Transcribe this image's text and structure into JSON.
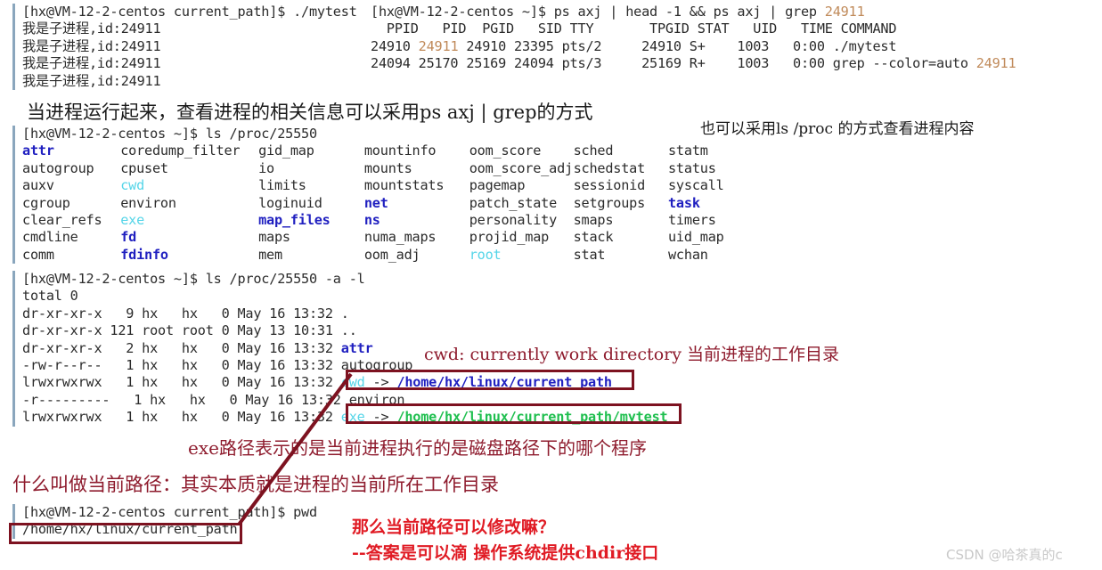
{
  "terminal_top_left": {
    "lines": [
      "[hx@VM-12-2-centos current_path]$ ./mytest",
      "我是子进程,id:24911",
      "我是子进程,id:24911",
      "我是子进程,id:24911",
      "我是子进程,id:24911"
    ]
  },
  "terminal_top_right": {
    "prompt": "[hx@VM-12-2-centos ~]$ ps axj | head -1 && ps axj | grep ",
    "prompt_pid": "24911",
    "header": "  PPID   PID  PGID   SID TTY       TPGID STAT   UID   TIME COMMAND",
    "rows": [
      {
        "pre": "24910 ",
        "pid": "24911",
        "post": " 24910 23395 pts/2     24910 S+    1003   0:00 ./mytest"
      },
      {
        "pre": "24094 25170 25169 24094 pts/3     25169 R+    1003   0:00 grep --color=auto ",
        "pid": "24911",
        "post": ""
      }
    ]
  },
  "annotation_ps": "当进程运行起来，查看进程的相关信息可以采用ps axj | grep的方式",
  "annotation_ls_proc": "也可以采用ls /proc 的方式查看进程内容",
  "terminal_proc_ls": {
    "prompt": "[hx@VM-12-2-centos ~]$ ls /proc/25550",
    "columns": [
      [
        {
          "name": "attr",
          "kind": "dir"
        },
        {
          "name": "autogroup",
          "kind": "plain"
        },
        {
          "name": "auxv",
          "kind": "plain"
        },
        {
          "name": "cgroup",
          "kind": "plain"
        },
        {
          "name": "clear_refs",
          "kind": "plain"
        },
        {
          "name": "cmdline",
          "kind": "plain"
        },
        {
          "name": "comm",
          "kind": "plain"
        }
      ],
      [
        {
          "name": "coredump_filter",
          "kind": "plain"
        },
        {
          "name": "cpuset",
          "kind": "plain"
        },
        {
          "name": "cwd",
          "kind": "link"
        },
        {
          "name": "environ",
          "kind": "plain"
        },
        {
          "name": "exe",
          "kind": "link"
        },
        {
          "name": "fd",
          "kind": "dir"
        },
        {
          "name": "fdinfo",
          "kind": "dir"
        }
      ],
      [
        {
          "name": "gid_map",
          "kind": "plain"
        },
        {
          "name": "io",
          "kind": "plain"
        },
        {
          "name": "limits",
          "kind": "plain"
        },
        {
          "name": "loginuid",
          "kind": "plain"
        },
        {
          "name": "map_files",
          "kind": "dir"
        },
        {
          "name": "maps",
          "kind": "plain"
        },
        {
          "name": "mem",
          "kind": "plain"
        }
      ],
      [
        {
          "name": "mountinfo",
          "kind": "plain"
        },
        {
          "name": "mounts",
          "kind": "plain"
        },
        {
          "name": "mountstats",
          "kind": "plain"
        },
        {
          "name": "net",
          "kind": "dir"
        },
        {
          "name": "ns",
          "kind": "dir"
        },
        {
          "name": "numa_maps",
          "kind": "plain"
        },
        {
          "name": "oom_adj",
          "kind": "plain"
        }
      ],
      [
        {
          "name": "oom_score",
          "kind": "plain"
        },
        {
          "name": "oom_score_adj",
          "kind": "plain"
        },
        {
          "name": "pagemap",
          "kind": "plain"
        },
        {
          "name": "patch_state",
          "kind": "plain"
        },
        {
          "name": "personality",
          "kind": "plain"
        },
        {
          "name": "projid_map",
          "kind": "plain"
        },
        {
          "name": "root",
          "kind": "link"
        }
      ],
      [
        {
          "name": "sched",
          "kind": "plain"
        },
        {
          "name": "schedstat",
          "kind": "plain"
        },
        {
          "name": "sessionid",
          "kind": "plain"
        },
        {
          "name": "setgroups",
          "kind": "plain"
        },
        {
          "name": "smaps",
          "kind": "plain"
        },
        {
          "name": "stack",
          "kind": "plain"
        },
        {
          "name": "stat",
          "kind": "plain"
        }
      ],
      [
        {
          "name": "statm",
          "kind": "plain"
        },
        {
          "name": "status",
          "kind": "plain"
        },
        {
          "name": "syscall",
          "kind": "plain"
        },
        {
          "name": "task",
          "kind": "dir"
        },
        {
          "name": "timers",
          "kind": "plain"
        },
        {
          "name": "uid_map",
          "kind": "plain"
        },
        {
          "name": "wchan",
          "kind": "plain"
        }
      ]
    ]
  },
  "terminal_proc_ll": {
    "prompt": "[hx@VM-12-2-centos ~]$ ls /proc/25550 -a -l",
    "total": "total 0",
    "entries": [
      {
        "meta": "dr-xr-xr-x   9 hx   hx   0 May 16 13:32 ",
        "name": ".",
        "kind": "plain",
        "arrow": "",
        "target": "",
        "target_kind": ""
      },
      {
        "meta": "dr-xr-xr-x 121 root root 0 May 13 10:31 ",
        "name": "..",
        "kind": "plain",
        "arrow": "",
        "target": "",
        "target_kind": ""
      },
      {
        "meta": "dr-xr-xr-x   2 hx   hx   0 May 16 13:32 ",
        "name": "attr",
        "kind": "dir",
        "arrow": "",
        "target": "",
        "target_kind": ""
      },
      {
        "meta": "-rw-r--r--   1 hx   hx   0 May 16 13:32 ",
        "name": "autogroup",
        "kind": "plain",
        "arrow": "",
        "target": "",
        "target_kind": ""
      },
      {
        "meta": "lrwxrwxrwx   1 hx   hx   0 May 16 13:32 ",
        "name": "cwd",
        "kind": "link",
        "arrow": " -> ",
        "target": "/home/hx/linux/current_path",
        "target_kind": "dir"
      },
      {
        "meta": "-r---------   1 hx   hx   0 May 16 13:32 ",
        "name": "environ",
        "kind": "plain",
        "arrow": "",
        "target": "",
        "target_kind": ""
      },
      {
        "meta": "lrwxrwxrwx   1 hx   hx   0 May 16 13:32 ",
        "name": "exe",
        "kind": "link",
        "arrow": " -> ",
        "target": "/home/hx/linux/current_path/mytest",
        "target_kind": "exe"
      }
    ]
  },
  "annotation_cwd": "cwd: currently work directory 当前进程的工作目录",
  "annotation_exe": "exe路径表示的是当前进程执行的是磁盘路径下的哪个程序",
  "annotation_current_path": "什么叫做当前路径：其实本质就是进程的当前所在工作目录",
  "terminal_pwd": {
    "prompt": "[hx@VM-12-2-centos current_path]$ pwd",
    "output": "/home/hx/linux/current_path"
  },
  "annotation_question": "那么当前路径可以修改嘛？",
  "annotation_answer": "--答案是可以滴 操作系统提供chdir接口",
  "watermark": "CSDN @哈茶真的c",
  "colors": {
    "terminal_text": "#2b2b2b",
    "terminal_bar": "#8aa6bd",
    "dir": "#2020c0",
    "symlink": "#55d5e8",
    "executable": "#1fbf4f",
    "grep_highlight": "#c08a5a",
    "annotation_dark_red": "#8e1b2d",
    "annotation_bright_red": "#e01b24",
    "box_border": "#7d1220",
    "watermark": "#c9c9c9"
  }
}
